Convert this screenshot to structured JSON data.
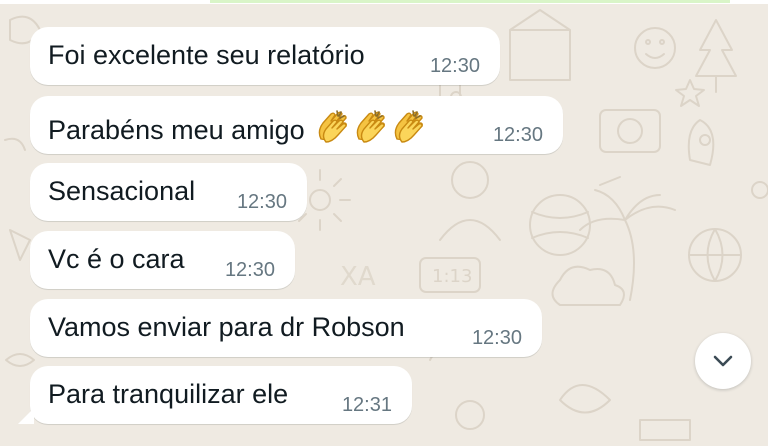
{
  "chat": {
    "messages": [
      {
        "text": "Foi excelente seu relatório",
        "time": "12:30"
      },
      {
        "text": "Parabéns meu amigo",
        "emoji": [
          "clapping-hands",
          "clapping-hands",
          "clapping-hands"
        ],
        "time": "12:30"
      },
      {
        "text": "Sensacional",
        "time": "12:30"
      },
      {
        "text": "Vc é o cara",
        "time": "12:30"
      },
      {
        "text": "Vamos enviar para dr Robson",
        "time": "12:30"
      },
      {
        "text": "Para tranquilizar ele",
        "time": "12:31"
      }
    ]
  },
  "colors": {
    "wallpaper": "#efeae2",
    "bubble": "#ffffff",
    "text": "#111b21",
    "timestamp": "#667781",
    "emoji": "#f5c342"
  },
  "icons": {
    "scroll_down": "chevron-down-icon"
  }
}
